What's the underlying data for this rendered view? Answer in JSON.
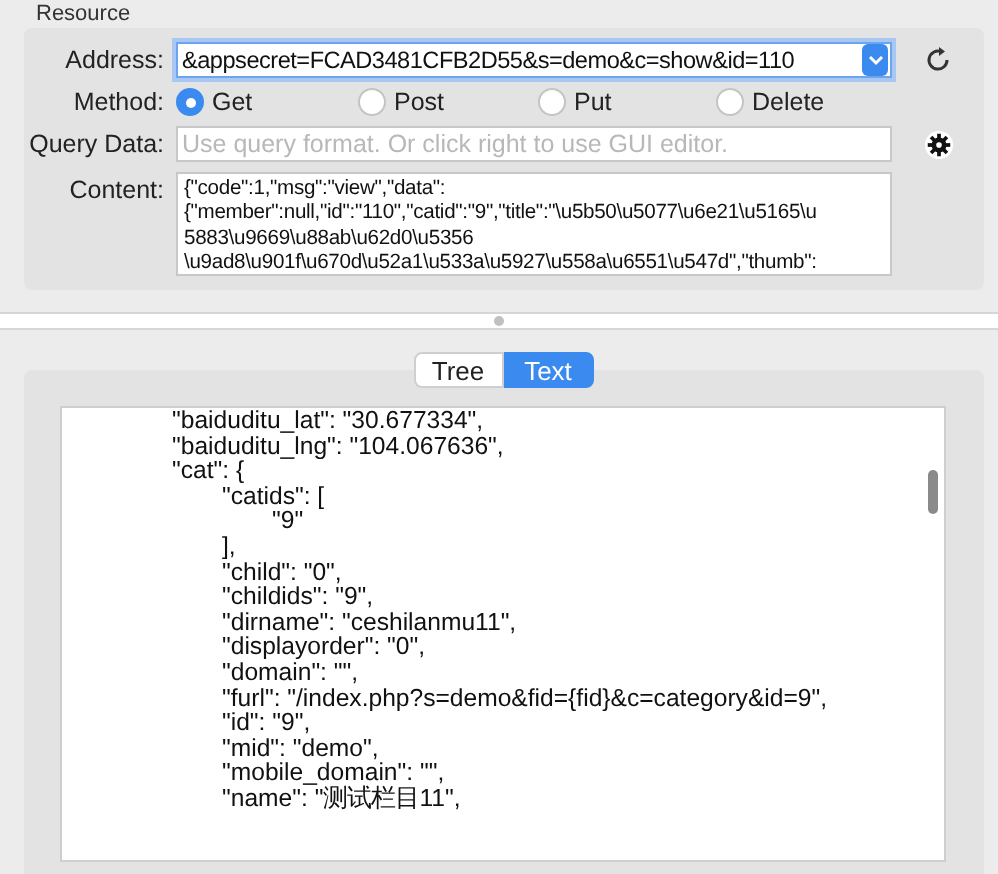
{
  "resource": {
    "title": "Resource",
    "address": {
      "label": "Address:",
      "value": "&appsecret=FCAD3481CFB2D55&s=demo&c=show&id=110"
    },
    "method": {
      "label": "Method:",
      "options": [
        {
          "label": "Get",
          "selected": true
        },
        {
          "label": "Post",
          "selected": false
        },
        {
          "label": "Put",
          "selected": false
        },
        {
          "label": "Delete",
          "selected": false
        }
      ]
    },
    "query": {
      "label": "Query Data:",
      "placeholder": "Use query format. Or click right to use GUI editor."
    },
    "content": {
      "label": "Content:",
      "lines": [
        "{\"code\":1,\"msg\":\"view\",\"data\":",
        "{\"member\":null,\"id\":\"110\",\"catid\":\"9\",\"title\":\"\\u5b50\\u5077\\u6e21\\u5165\\u",
        "5883\\u9669\\u88ab\\u62d0\\u5356",
        "\\u9ad8\\u901f\\u670d\\u52a1\\u533a\\u5927\\u558a\\u6551\\u547d\",\"thumb\":"
      ]
    }
  },
  "view_tabs": [
    {
      "label": "Tree",
      "selected": false
    },
    {
      "label": "Text",
      "selected": true
    }
  ],
  "response": {
    "lines": [
      {
        "text": "\"baiduditu_lat\": \"30.677334\","
      },
      {
        "text": "\"baiduditu_lng\": \"104.067636\","
      },
      {
        "text": "\"cat\": {",
        "children": [
          {
            "text": "\"catids\": [",
            "children": [
              {
                "text": "\"9\""
              }
            ]
          },
          {
            "text": "],"
          },
          {
            "text": "\"child\": \"0\","
          },
          {
            "text": "\"childids\": \"9\","
          },
          {
            "text": "\"dirname\": \"ceshilanmu11\","
          },
          {
            "text": "\"displayorder\": \"0\","
          },
          {
            "text": "\"domain\": \"\","
          },
          {
            "text": "\"furl\": \"/index.php?s=demo&fid={fid}&c=category&id=9\","
          },
          {
            "text": "\"id\": \"9\","
          },
          {
            "text": "\"mid\": \"demo\","
          },
          {
            "text": "\"mobile_domain\": \"\","
          },
          {
            "text": "\"name\": \"测试栏目11\","
          }
        ]
      }
    ]
  }
}
